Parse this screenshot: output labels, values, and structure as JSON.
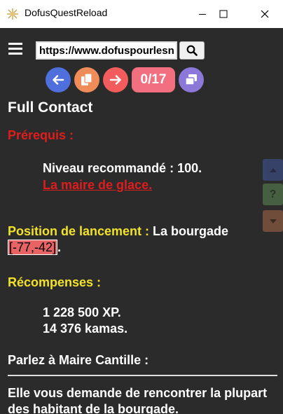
{
  "window": {
    "title": "DofusQuestReload"
  },
  "toolbar": {
    "url_value": "https://www.dofuspourlesnoobs.com",
    "counter": "0/17"
  },
  "quest": {
    "title": "Full Contact",
    "prerequis_label": "Prérequis :",
    "niveau": "Niveau recommandé : 100.",
    "prerequis_link": "La maire de glace.",
    "position_label": "Position de lancement :",
    "position_place": " La bourgade",
    "position_coords": "[-77,-42]",
    "position_end": ".",
    "recompenses_label": "Récompenses :",
    "xp": "1 228 500 XP.",
    "kamas": "14 376 kamas.",
    "step_title": "Parlez à Maire Cantille :",
    "step_text": "Elle vous demande de rencontrer la plupart des habitant de la bourgade."
  },
  "colors": {
    "background": "#2b2b2b",
    "prerequis_red": "#e01d1d",
    "label_yellow": "#f2e22a",
    "counter_pink": "#f26f80",
    "back_blue": "#4e6fdc",
    "copy_orange": "#f08c5a",
    "next_red": "#f25c5c",
    "clone_purple": "#8c78d8"
  },
  "icons": [
    "menu-icon",
    "search-icon",
    "arrow-left-icon",
    "copy-icon",
    "arrow-right-icon",
    "windows-icon",
    "chevron-up-icon",
    "help-icon",
    "chevron-down-icon"
  ]
}
